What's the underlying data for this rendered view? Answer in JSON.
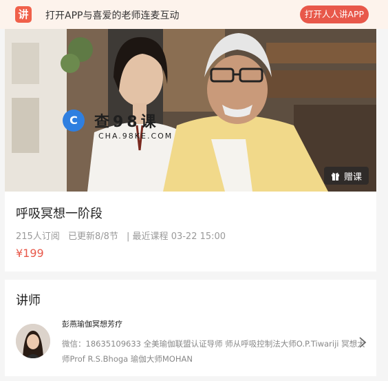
{
  "banner": {
    "logo_glyph": "讲",
    "text": "打开APP与喜爱的老师连麦互动",
    "open_button": "打开人人讲APP",
    "accent_color": "#e8584a"
  },
  "cover": {
    "watermark_main": "查98课",
    "watermark_sub": "CHA.98KE.COM",
    "gift_button": "赠课"
  },
  "course": {
    "title": "呼吸冥想一阶段",
    "subscribers": "215人订阅",
    "updated": "已更新8/8节",
    "latest": "| 最近课程 03-22 15:00",
    "price": "¥199"
  },
  "teacher": {
    "heading": "讲师",
    "name": "彭燕瑜伽冥想芳疗",
    "description": "微信：18635109633 全美瑜伽联盟认证导师 师从呼吸控制法大师O.P.Tiwariji 冥想大师Prof R.S.Bhoga 瑜伽大师MOHAN"
  }
}
